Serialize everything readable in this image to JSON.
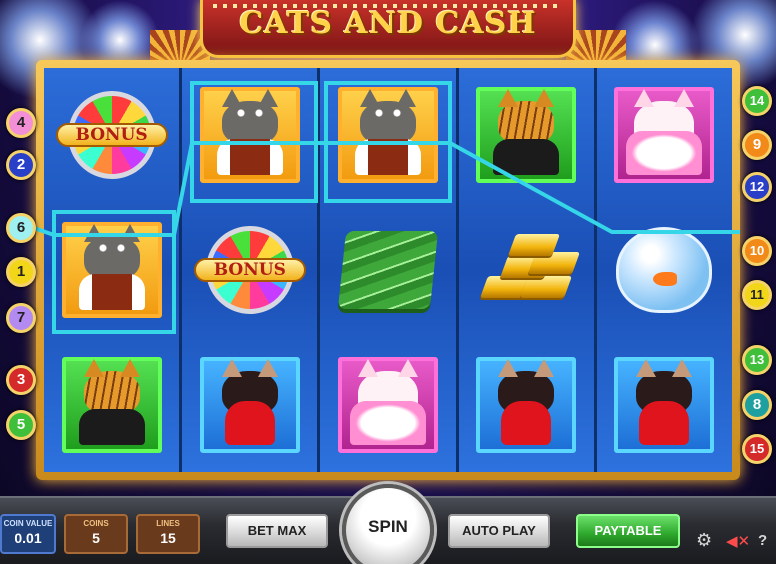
{
  "title": "CATS AND CASH",
  "symbols": {
    "bonus": "BONUS"
  },
  "line_badges": {
    "left": [
      "4",
      "2",
      "6",
      "1",
      "7",
      "3",
      "5"
    ],
    "right": [
      "14",
      "9",
      "12",
      "10",
      "11",
      "13",
      "8",
      "15"
    ]
  },
  "controls": {
    "coin_value_label": "COIN VALUE",
    "coin_value": "0.01",
    "coins_label": "COINS",
    "coins": "5",
    "lines_label": "LINES",
    "lines": "15",
    "bet_max": "BET MAX",
    "spin": "SPIN",
    "auto_play": "AUTO PLAY",
    "paytable": "PAYTABLE",
    "help": "?",
    "settings_icon": "gear-icon",
    "sound_icon": "speaker-muted-icon"
  },
  "colors": {
    "payline": "#35d6e8",
    "badge_red": "#d42a2a",
    "badge_blue": "#2a3fc8",
    "badge_yellow": "#f2d61a",
    "badge_pink": "#f28fd6",
    "badge_cyan": "#9ff0f0",
    "badge_green": "#3fbf3a",
    "badge_purple": "#b28af2",
    "badge_orange": "#f28a1a",
    "badge_teal": "#1fa0a0"
  }
}
